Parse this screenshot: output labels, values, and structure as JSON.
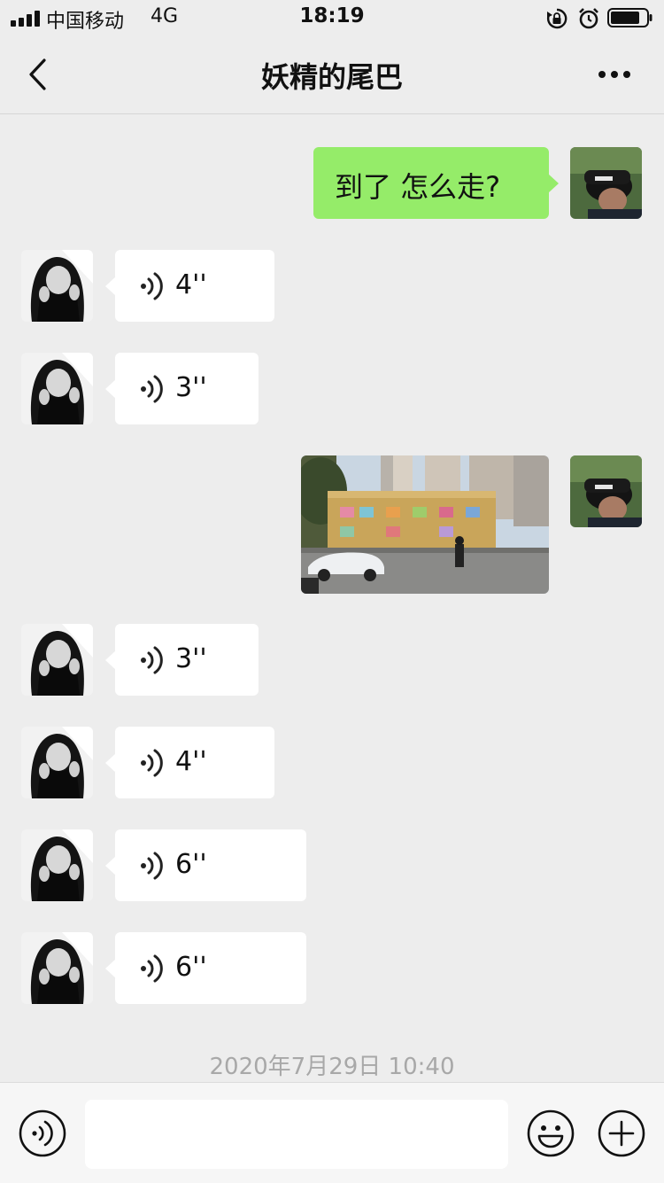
{
  "status_bar": {
    "carrier": "中国移动",
    "network": "4G",
    "time": "18:19",
    "icons": [
      "signal-icon",
      "rotation-lock-icon",
      "alarm-icon",
      "battery-icon"
    ]
  },
  "nav": {
    "title": "妖精的尾巴",
    "back_icon": "chevron-left-icon",
    "more_icon": "more-horizontal-icon"
  },
  "messages": [
    {
      "sender": "self",
      "type": "text",
      "text": "到了 怎么走?"
    },
    {
      "sender": "other",
      "type": "voice",
      "duration": "4''"
    },
    {
      "sender": "other",
      "type": "voice",
      "duration": "3''"
    },
    {
      "sender": "self",
      "type": "image"
    },
    {
      "sender": "other",
      "type": "voice",
      "duration": "3''"
    },
    {
      "sender": "other",
      "type": "voice",
      "duration": "4''"
    },
    {
      "sender": "other",
      "type": "voice",
      "duration": "6''"
    },
    {
      "sender": "other",
      "type": "voice",
      "duration": "6''"
    }
  ],
  "timestamp": "2020年7月29日 10:40",
  "input_bar": {
    "placeholder": "",
    "icons": [
      "voice-mode-icon",
      "emoji-icon",
      "plus-icon"
    ]
  },
  "colors": {
    "background": "#ededed",
    "self_bubble": "#95ec69",
    "other_bubble": "#ffffff",
    "timestamp": "#a8a8a8"
  }
}
